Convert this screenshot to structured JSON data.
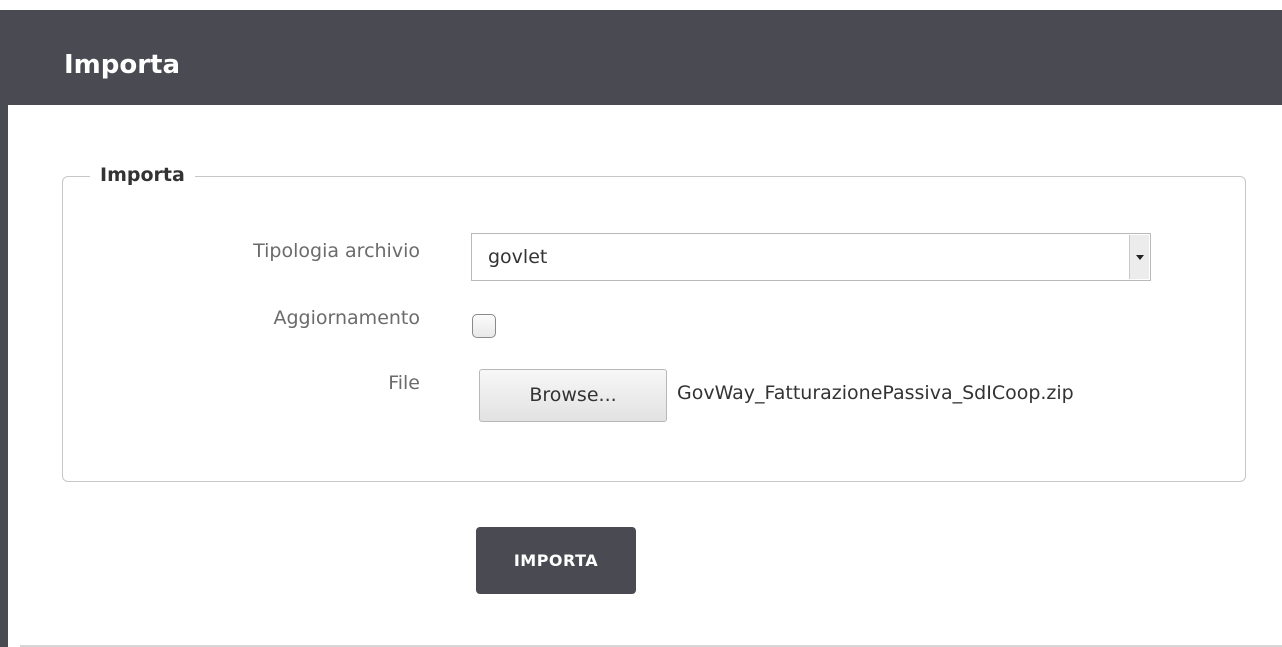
{
  "header": {
    "title": "Importa"
  },
  "form": {
    "legend": "Importa",
    "tipologia": {
      "label": "Tipologia archivio",
      "value": "govlet"
    },
    "aggiornamento": {
      "label": "Aggiornamento",
      "checked": false
    },
    "file": {
      "label": "File",
      "browse_label": "Browse...",
      "file_name": "GovWay_FatturazionePassiva_SdICoop.zip"
    },
    "submit_label": "IMPORTA"
  },
  "colors": {
    "header_bg": "#4a4a52",
    "button_bg": "#4a4a52",
    "header_text": "#ffffff"
  }
}
